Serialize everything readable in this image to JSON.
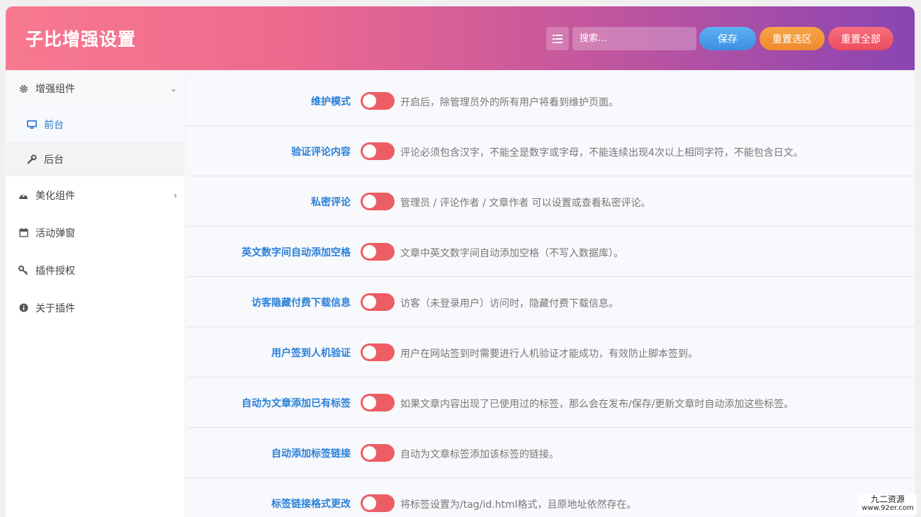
{
  "header": {
    "title": "子比增强设置",
    "search_placeholder": "搜索...",
    "save_label": "保存",
    "reset_section_label": "重置选区",
    "reset_all_label": "重置全部"
  },
  "sidebar": {
    "items": [
      {
        "label": "增强组件",
        "icon": "gear-icon"
      },
      {
        "label": "前台",
        "icon": "desktop-icon"
      },
      {
        "label": "后台",
        "icon": "wrench-icon"
      },
      {
        "label": "美化组件",
        "icon": "palette-icon"
      },
      {
        "label": "活动弹窗",
        "icon": "calendar-icon"
      },
      {
        "label": "插件授权",
        "icon": "key-icon"
      },
      {
        "label": "关于插件",
        "icon": "info-icon"
      }
    ]
  },
  "settings": [
    {
      "label": "维护模式",
      "desc": "开启后，除管理员外的所有用户将看到维护页面。",
      "enabled": true
    },
    {
      "label": "验证评论内容",
      "desc": "评论必须包含汉字，不能全是数字或字母，不能连续出现4次以上相同字符，不能包含日文。",
      "enabled": true
    },
    {
      "label": "私密评论",
      "desc": "管理员 / 评论作者 / 文章作者 可以设置或查看私密评论。",
      "enabled": true
    },
    {
      "label": "英文数字间自动添加空格",
      "desc": "文章中英文数字间自动添加空格（不写入数据库）。",
      "enabled": true
    },
    {
      "label": "访客隐藏付费下载信息",
      "desc": "访客（未登录用户）访问时，隐藏付费下载信息。",
      "enabled": true
    },
    {
      "label": "用户签到人机验证",
      "desc": "用户在网站签到时需要进行人机验证才能成功，有效防止脚本签到。",
      "enabled": true
    },
    {
      "label": "自动为文章添加已有标签",
      "desc": "如果文章内容出现了已使用过的标签，那么会在发布/保存/更新文章时自动添加这些标签。",
      "enabled": true
    },
    {
      "label": "自动添加标签链接",
      "desc": "自动为文章标签添加该标签的链接。",
      "enabled": true
    },
    {
      "label": "标签链接格式更改",
      "desc": "将标签设置为/tag/id.html格式，且原地址依然存在。",
      "enabled": true
    }
  ],
  "watermark": {
    "line1": "九二资源",
    "line2": "www.92er.com"
  },
  "colors": {
    "accent_blue": "#2a80d8",
    "toggle_red": "#ec5e64",
    "save_blue": "#4a9fe9",
    "reset_orange": "#f2962f",
    "reset_red": "#f05a6a"
  }
}
